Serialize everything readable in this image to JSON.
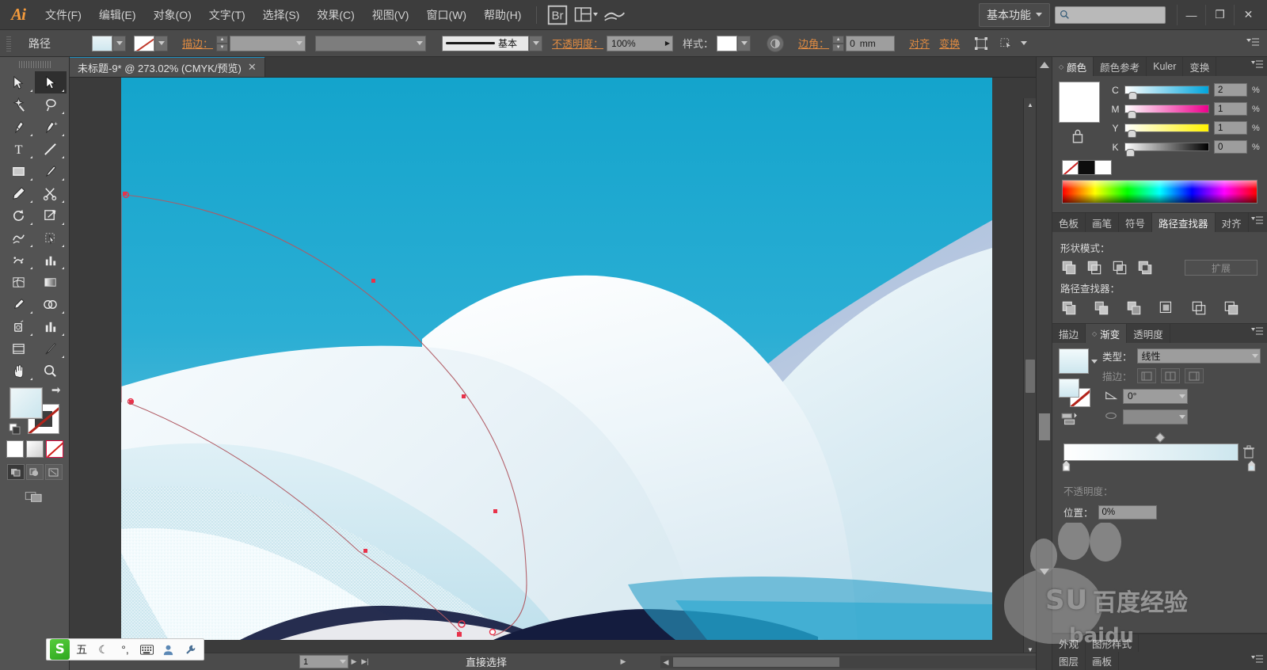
{
  "app": {
    "logo": "Ai",
    "menus": [
      {
        "label": "文件(F)",
        "name": "menu-file"
      },
      {
        "label": "编辑(E)",
        "name": "menu-edit"
      },
      {
        "label": "对象(O)",
        "name": "menu-object"
      },
      {
        "label": "文字(T)",
        "name": "menu-type"
      },
      {
        "label": "选择(S)",
        "name": "menu-select"
      },
      {
        "label": "效果(C)",
        "name": "menu-effect"
      },
      {
        "label": "视图(V)",
        "name": "menu-view"
      },
      {
        "label": "窗口(W)",
        "name": "menu-window"
      },
      {
        "label": "帮助(H)",
        "name": "menu-help"
      }
    ],
    "workspace": "基本功能",
    "search_placeholder": "",
    "window_controls": {
      "minimize": "—",
      "maximize": "❐",
      "close": "✕"
    }
  },
  "control_bar": {
    "selection_label": "路径",
    "fill_label": "",
    "stroke_link": "描边：",
    "stroke_weight": "",
    "stroke_profile": "",
    "brush_label": "基本",
    "opacity_label": "不透明度：",
    "opacity_value": "100%",
    "style_label": "样式：",
    "corner_label": "边角：",
    "corner_value": "0",
    "corner_unit": "mm",
    "align_label": "对齐",
    "transform_label": "变换"
  },
  "document": {
    "tab_title": "未标题-9* @ 273.02% (CMYK/预览)",
    "close_glyph": "✕"
  },
  "tools": {
    "rows": [
      [
        {
          "label": "选择工具",
          "name": "tool-selection",
          "icon": "arrow-black-icon",
          "active": false
        },
        {
          "label": "直接选择工具",
          "name": "tool-direct-selection",
          "icon": "arrow-white-icon",
          "active": true
        }
      ],
      [
        {
          "label": "魔棒工具",
          "name": "tool-magic-wand",
          "icon": "magic-wand-icon",
          "active": false
        },
        {
          "label": "套索工具",
          "name": "tool-lasso",
          "icon": "lasso-icon",
          "active": false
        }
      ],
      [
        {
          "label": "钢笔工具",
          "name": "tool-pen",
          "icon": "pen-icon",
          "active": false
        },
        {
          "label": "添加锚点工具",
          "name": "tool-add-anchor",
          "icon": "pen-add-icon",
          "active": false
        }
      ],
      [
        {
          "label": "文字工具",
          "name": "tool-type",
          "icon": "type-icon",
          "active": false
        },
        {
          "label": "直线段工具",
          "name": "tool-line",
          "icon": "line-segment-icon",
          "active": false
        }
      ],
      [
        {
          "label": "矩形工具",
          "name": "tool-rectangle",
          "icon": "rectangle-icon",
          "active": false
        },
        {
          "label": "画笔工具",
          "name": "tool-paintbrush",
          "icon": "paintbrush-icon",
          "active": false
        }
      ],
      [
        {
          "label": "铅笔工具",
          "name": "tool-pencil",
          "icon": "pencil-icon",
          "active": false
        },
        {
          "label": "剪刀工具",
          "name": "tool-scissors",
          "icon": "scissors-icon",
          "active": false
        }
      ],
      [
        {
          "label": "旋转工具",
          "name": "tool-rotate",
          "icon": "rotate-icon",
          "active": false
        },
        {
          "label": "比例缩放工具",
          "name": "tool-scale",
          "icon": "scale-icon",
          "active": false
        }
      ],
      [
        {
          "label": "变形工具",
          "name": "tool-warp",
          "icon": "warp-icon",
          "active": false
        },
        {
          "label": "自由变换工具",
          "name": "tool-free-transform",
          "icon": "free-transform-icon",
          "active": false
        }
      ],
      [
        {
          "label": "符号喷枪工具",
          "name": "tool-symbol-sprayer",
          "icon": "symbol-sprayer-icon",
          "active": false
        },
        {
          "label": "柱形图工具",
          "name": "tool-column-graph",
          "icon": "column-graph-icon",
          "active": false
        }
      ],
      [
        {
          "label": "网格工具",
          "name": "tool-mesh",
          "icon": "mesh-icon",
          "active": false
        },
        {
          "label": "渐变工具",
          "name": "tool-gradient",
          "icon": "gradient-icon",
          "active": false
        }
      ],
      [
        {
          "label": "吸管工具",
          "name": "tool-eyedropper",
          "icon": "eyedropper-icon",
          "active": false
        },
        {
          "label": "混合工具",
          "name": "tool-blend",
          "icon": "blend-icon",
          "active": false
        }
      ],
      [
        {
          "label": "实时上色工具",
          "name": "tool-live-paint",
          "icon": "live-paint-icon",
          "active": false
        },
        {
          "label": "图表工具",
          "name": "tool-graph",
          "icon": "graph-icon",
          "active": false
        }
      ],
      [
        {
          "label": "画板工具",
          "name": "tool-artboard",
          "icon": "artboard-icon",
          "active": false
        },
        {
          "label": "切片工具",
          "name": "tool-slice",
          "icon": "slice-icon",
          "active": false
        }
      ],
      [
        {
          "label": "抓手工具",
          "name": "tool-hand",
          "icon": "hand-icon",
          "active": false
        },
        {
          "label": "缩放工具",
          "name": "tool-zoom",
          "icon": "magnifier-icon",
          "active": false
        }
      ]
    ],
    "fill_stroke": {
      "fill_label": "填色",
      "stroke_label": "描边"
    },
    "paint_modes": [
      {
        "label": "颜色",
        "name": "paint-mode-color"
      },
      {
        "label": "渐变",
        "name": "paint-mode-gradient"
      },
      {
        "label": "无",
        "name": "paint-mode-none"
      }
    ],
    "draw_modes": [
      {
        "label": "正常绘图",
        "name": "draw-mode-normal"
      },
      {
        "label": "背面绘图",
        "name": "draw-mode-behind"
      },
      {
        "label": "内部绘图",
        "name": "draw-mode-inside"
      }
    ],
    "screen_mode": {
      "label": "更改屏幕模式",
      "name": "screen-mode-button"
    }
  },
  "color_panel": {
    "tabs": [
      {
        "label": "颜色",
        "active": true,
        "name": "tab-color"
      },
      {
        "label": "颜色参考",
        "active": false,
        "name": "tab-color-guide"
      },
      {
        "label": "Kuler",
        "active": false,
        "name": "tab-kuler"
      },
      {
        "label": "变换",
        "active": false,
        "name": "tab-transform"
      }
    ],
    "sliders": [
      {
        "label": "C",
        "value": "2",
        "unit": "%",
        "pos": 4
      },
      {
        "label": "M",
        "value": "1",
        "unit": "%",
        "pos": 3
      },
      {
        "label": "Y",
        "value": "1",
        "unit": "%",
        "pos": 3
      },
      {
        "label": "K",
        "value": "0",
        "unit": "%",
        "pos": 1
      }
    ],
    "swatch_none": "无",
    "swatch_black": "黑色",
    "swatch_white": "白色"
  },
  "pathfinder_panel": {
    "tabs": [
      {
        "label": "色板",
        "active": false,
        "name": "tab-swatches"
      },
      {
        "label": "画笔",
        "active": false,
        "name": "tab-brushes"
      },
      {
        "label": "符号",
        "active": false,
        "name": "tab-symbols"
      },
      {
        "label": "路径查找器",
        "active": true,
        "name": "tab-pathfinder"
      },
      {
        "label": "对齐",
        "active": false,
        "name": "tab-align"
      }
    ],
    "shape_modes_label": "形状模式：",
    "shape_modes": [
      {
        "label": "联集",
        "name": "pf-unite"
      },
      {
        "label": "减去顶层",
        "name": "pf-minus-front"
      },
      {
        "label": "交集",
        "name": "pf-intersect"
      },
      {
        "label": "差集",
        "name": "pf-exclude"
      }
    ],
    "expand_label": "扩展",
    "pathfinders_label": "路径查找器：",
    "pathfinders": [
      {
        "label": "分割",
        "name": "pf-divide"
      },
      {
        "label": "修边",
        "name": "pf-trim"
      },
      {
        "label": "合并",
        "name": "pf-merge"
      },
      {
        "label": "裁剪",
        "name": "pf-crop"
      },
      {
        "label": "轮廓",
        "name": "pf-outline"
      },
      {
        "label": "减去后方对象",
        "name": "pf-minus-back"
      }
    ]
  },
  "gradient_panel": {
    "tabs": [
      {
        "label": "描边",
        "active": false,
        "name": "tab-stroke"
      },
      {
        "label": "渐变",
        "active": true,
        "name": "tab-gradient"
      },
      {
        "label": "透明度",
        "active": false,
        "name": "tab-transparency"
      }
    ],
    "type_label": "类型：",
    "type_value": "线性",
    "stroke_label": "描边：",
    "angle_label": "角度",
    "angle_value": "0°",
    "aspect_value": "",
    "position_label": "位置：",
    "position_value": "0%",
    "opacity_label": "不透明度："
  },
  "bottom_panels": {
    "row1": [
      {
        "label": "外观",
        "name": "tab-appearance"
      },
      {
        "label": "图形样式",
        "name": "tab-graphic-styles"
      }
    ],
    "row2": [
      {
        "label": "图层",
        "name": "tab-layers"
      },
      {
        "label": "画板",
        "name": "tab-artboards"
      }
    ]
  },
  "status_bar": {
    "page_value": "1",
    "tool_status": "直接选择"
  },
  "ime": {
    "logo": "S",
    "items": [
      {
        "glyph": "五",
        "name": "ime-input-mode"
      },
      {
        "glyph": "☾",
        "name": "ime-moon-icon"
      },
      {
        "glyph": "°,",
        "name": "ime-punctuation-icon"
      },
      {
        "glyph": "▦",
        "name": "ime-keyboard-icon"
      },
      {
        "glyph": "👤",
        "name": "ime-user-icon"
      },
      {
        "glyph": "🔧",
        "name": "ime-settings-icon"
      }
    ]
  },
  "watermark": {
    "line1": "百度经验",
    "line2": "baidu",
    "logo": "SU"
  },
  "colors": {
    "accent": "#e08b42",
    "sky": "#1ba7cf",
    "panel_bg": "#4a4a4a",
    "anchor": "#e8324a"
  }
}
